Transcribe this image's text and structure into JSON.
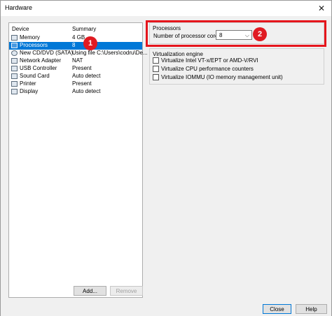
{
  "window": {
    "title": "Hardware",
    "close_glyph": "✕"
  },
  "devices": {
    "header_device": "Device",
    "header_summary": "Summary",
    "items": [
      {
        "name": "Memory",
        "summary": "4 GB",
        "icon": "memory-icon",
        "selected": false
      },
      {
        "name": "Processors",
        "summary": "8",
        "icon": "processor-icon",
        "selected": true
      },
      {
        "name": "New CD/DVD (SATA)",
        "summary": "Using file C:\\Users\\codru\\De...",
        "icon": "cd-dvd-icon",
        "selected": false
      },
      {
        "name": "Network Adapter",
        "summary": "NAT",
        "icon": "network-adapter-icon",
        "selected": false
      },
      {
        "name": "USB Controller",
        "summary": "Present",
        "icon": "usb-icon",
        "selected": false
      },
      {
        "name": "Sound Card",
        "summary": "Auto detect",
        "icon": "speaker-icon",
        "selected": false
      },
      {
        "name": "Printer",
        "summary": "Present",
        "icon": "printer-icon",
        "selected": false
      },
      {
        "name": "Display",
        "summary": "Auto detect",
        "icon": "display-icon",
        "selected": false
      }
    ],
    "add_label": "Add...",
    "remove_label": "Remove"
  },
  "processors": {
    "group_title": "Processors",
    "cores_label": "Number of processor cores:",
    "cores_value": "8"
  },
  "virtualization": {
    "group_title": "Virtualization engine",
    "options": [
      {
        "label": "Virtualize Intel VT-x/EPT or AMD-V/RVI",
        "checked": false
      },
      {
        "label": "Virtualize CPU performance counters",
        "checked": false
      },
      {
        "label": "Virtualize IOMMU (IO memory management unit)",
        "checked": false
      }
    ]
  },
  "annotations": {
    "badge_1": "1",
    "badge_2": "2",
    "color": "#e01b22"
  },
  "footer": {
    "close_label": "Close",
    "help_label": "Help"
  }
}
